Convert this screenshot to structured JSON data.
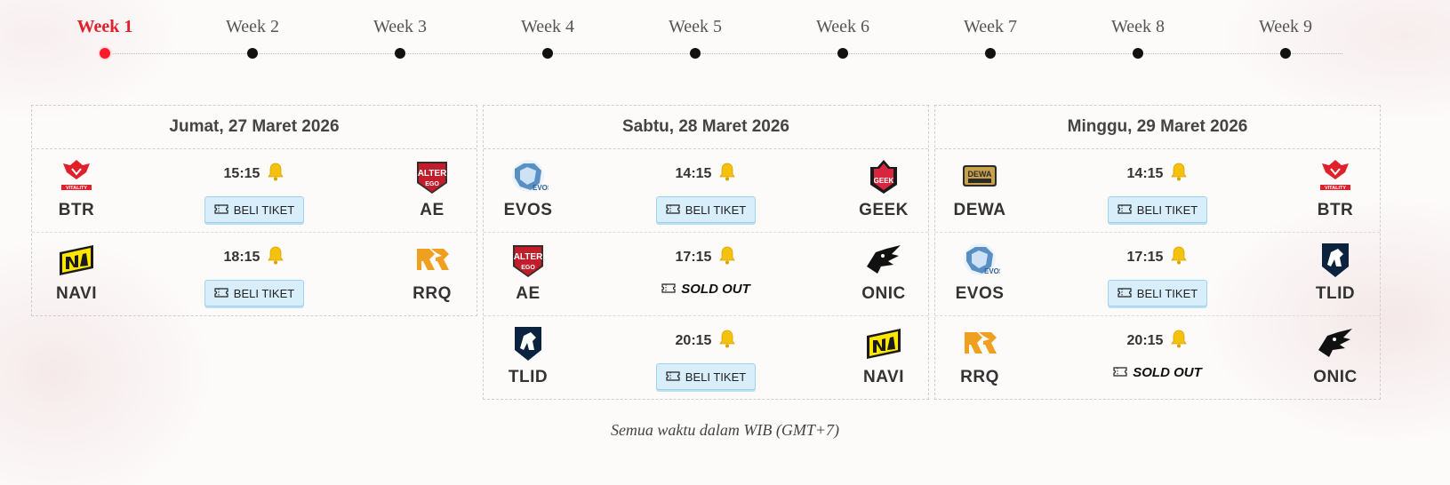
{
  "weeks": [
    "Week 1",
    "Week 2",
    "Week 3",
    "Week 4",
    "Week 5",
    "Week 6",
    "Week 7",
    "Week 8",
    "Week 9"
  ],
  "active_week": "Week 1",
  "colors": {
    "active": "#e0202a",
    "button_bg": "#d8eefa",
    "bell": "#f4c20d"
  },
  "days": [
    {
      "date": "Jumat, 27 Maret 2026",
      "matches": [
        {
          "home": "BTR",
          "away": "AE",
          "time": "15:15",
          "ticket": "BELI TIKET",
          "sold_out": false
        },
        {
          "home": "NAVI",
          "away": "RRQ",
          "time": "18:15",
          "ticket": "BELI TIKET",
          "sold_out": false
        }
      ]
    },
    {
      "date": "Sabtu, 28 Maret 2026",
      "matches": [
        {
          "home": "EVOS",
          "away": "GEEK",
          "time": "14:15",
          "ticket": "BELI TIKET",
          "sold_out": false
        },
        {
          "home": "AE",
          "away": "ONIC",
          "time": "17:15",
          "ticket": "SOLD OUT",
          "sold_out": true
        },
        {
          "home": "TLID",
          "away": "NAVI",
          "time": "20:15",
          "ticket": "BELI TIKET",
          "sold_out": false
        }
      ]
    },
    {
      "date": "Minggu, 29 Maret 2026",
      "matches": [
        {
          "home": "DEWA",
          "away": "BTR",
          "time": "14:15",
          "ticket": "BELI TIKET",
          "sold_out": false
        },
        {
          "home": "EVOS",
          "away": "TLID",
          "time": "17:15",
          "ticket": "BELI TIKET",
          "sold_out": false
        },
        {
          "home": "RRQ",
          "away": "ONIC",
          "time": "20:15",
          "ticket": "SOLD OUT",
          "sold_out": true
        }
      ]
    }
  ],
  "footer_note": "Semua waktu dalam WIB (GMT+7)",
  "icons": {
    "reminder": "bell-icon",
    "ticket": "ticket-icon"
  }
}
